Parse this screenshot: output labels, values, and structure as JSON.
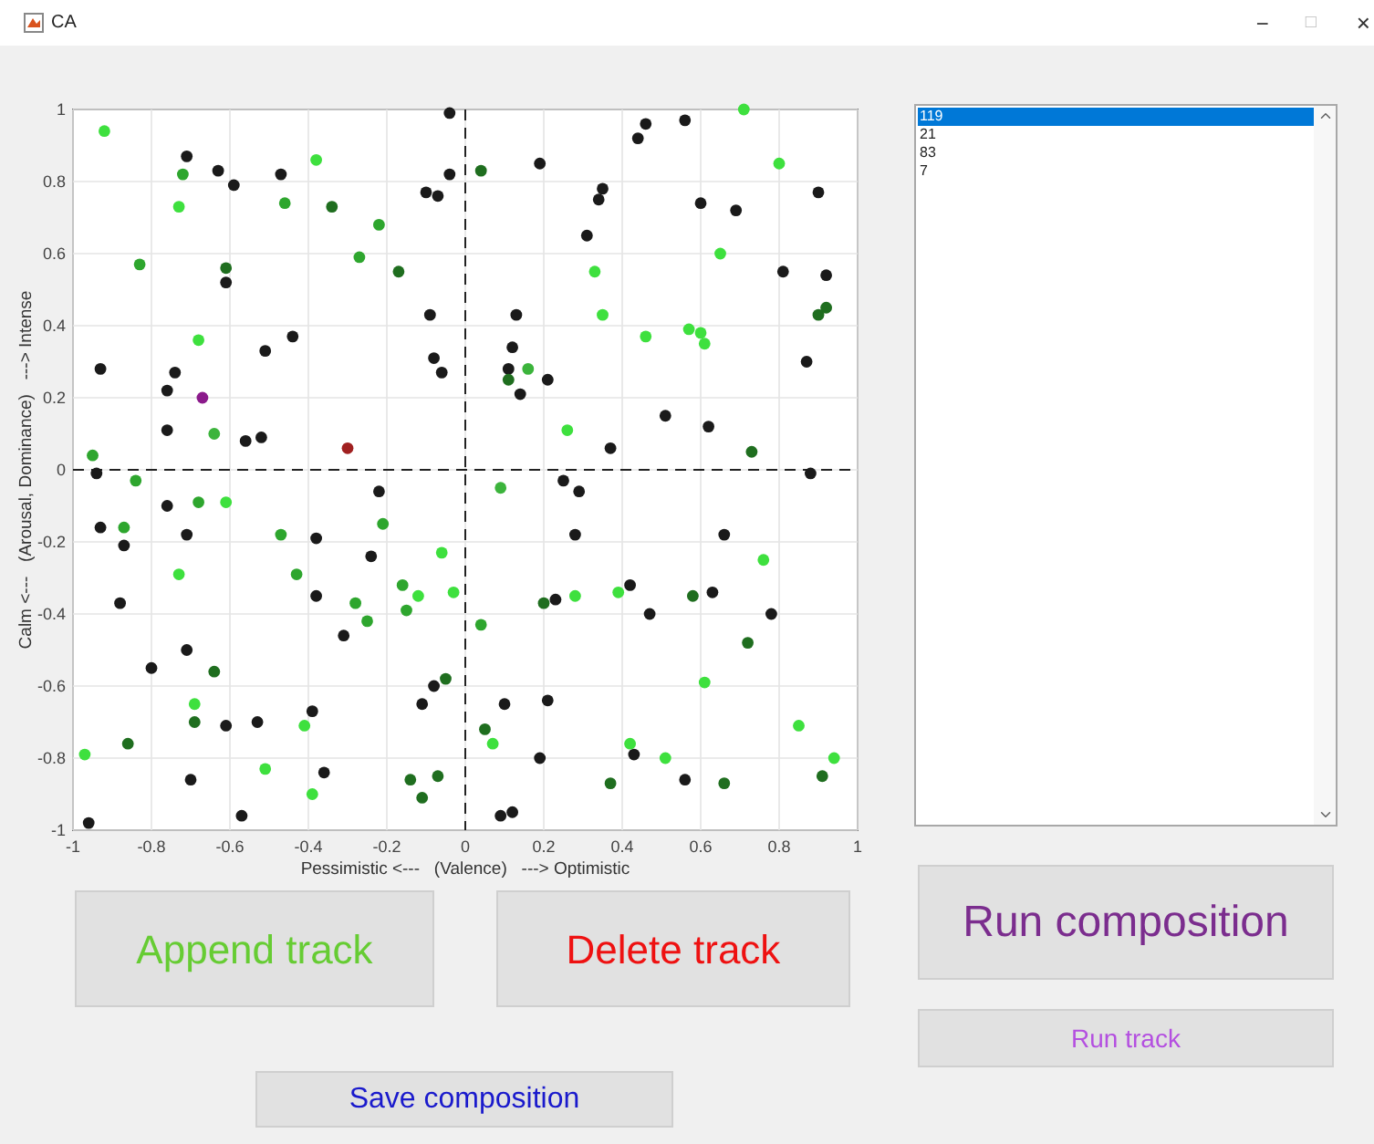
{
  "window": {
    "title": "CA",
    "controls": [
      "−",
      "□",
      "×"
    ]
  },
  "chart": {
    "chart_data": {
      "type": "scatter",
      "xlabel": "Pessimistic <---   (Valence)   ---> Optimistic",
      "ylabel": "Calm <---   (Arousal, Dominance)   ---> Intense",
      "xlim": [
        -1,
        1
      ],
      "ylim": [
        -1,
        1
      ],
      "xticks": [
        {
          "value": -1,
          "label": "-1"
        },
        {
          "value": -0.8,
          "label": "-0.8"
        },
        {
          "value": -0.6,
          "label": "-0.6"
        },
        {
          "value": -0.4,
          "label": "-0.4"
        },
        {
          "value": -0.2,
          "label": "-0.2"
        },
        {
          "value": 0,
          "label": "0"
        },
        {
          "value": 0.2,
          "label": "0.2"
        },
        {
          "value": 0.4,
          "label": "0.4"
        },
        {
          "value": 0.6,
          "label": "0.6"
        },
        {
          "value": 0.8,
          "label": "0.8"
        },
        {
          "value": 1,
          "label": "1"
        }
      ],
      "yticks": [
        {
          "value": -1,
          "label": "-1"
        },
        {
          "value": -0.8,
          "label": "-0.8"
        },
        {
          "value": -0.6,
          "label": "-0.6"
        },
        {
          "value": -0.4,
          "label": "-0.4"
        },
        {
          "value": -0.2,
          "label": "-0.2"
        },
        {
          "value": 0,
          "label": "0"
        },
        {
          "value": 0.2,
          "label": "0.2"
        },
        {
          "value": 0.4,
          "label": "0.4"
        },
        {
          "value": 0.6,
          "label": "0.6"
        },
        {
          "value": 0.8,
          "label": "0.8"
        },
        {
          "value": 1,
          "label": "1"
        }
      ],
      "grid": true,
      "series": [
        {
          "color": "#1a1a1a",
          "x": [
            -0.93,
            -0.71,
            -0.76,
            -0.74,
            -0.76,
            -0.63,
            -0.59,
            -0.61,
            -0.47,
            -0.51,
            -0.44,
            -0.56,
            -0.52,
            -0.1,
            -0.07,
            -0.04,
            -0.04,
            -0.09,
            -0.08,
            -0.06,
            -0.94,
            -0.22,
            0.46,
            0.44,
            0.56,
            0.19,
            0.35,
            0.34,
            0.31,
            0.6,
            0.69,
            0.9,
            0.81,
            0.92,
            0.13,
            0.12,
            0.11,
            0.21,
            0.14,
            0.51,
            0.62,
            0.87,
            0.37,
            0.88,
            0.25,
            0.29,
            -0.76,
            -0.93,
            -0.71,
            -0.87,
            -0.38,
            -0.24,
            -0.88,
            -0.38,
            -0.31,
            -0.71,
            -0.8,
            -0.08,
            -0.11,
            -0.61,
            -0.53,
            -0.39,
            -0.7,
            -0.36,
            -0.57,
            -0.96,
            0.28,
            0.66,
            0.42,
            0.23,
            0.63,
            0.47,
            0.78,
            0.1,
            0.21,
            0.19,
            0.43,
            0.56,
            0.09,
            0.12
          ],
          "values": [
            0.28,
            0.87,
            0.22,
            0.27,
            0.11,
            0.83,
            0.79,
            0.52,
            0.82,
            0.33,
            0.37,
            0.08,
            0.09,
            0.77,
            0.76,
            0.82,
            0.99,
            0.43,
            0.31,
            0.27,
            -0.01,
            -0.06,
            0.96,
            0.92,
            0.97,
            0.85,
            0.78,
            0.75,
            0.65,
            0.74,
            0.72,
            0.77,
            0.55,
            0.54,
            0.43,
            0.34,
            0.28,
            0.25,
            0.21,
            0.15,
            0.12,
            0.3,
            0.06,
            -0.01,
            -0.03,
            -0.06,
            -0.1,
            -0.16,
            -0.18,
            -0.21,
            -0.19,
            -0.24,
            -0.37,
            -0.35,
            -0.46,
            -0.5,
            -0.55,
            -0.6,
            -0.65,
            -0.71,
            -0.7,
            -0.67,
            -0.86,
            -0.84,
            -0.96,
            -0.98,
            -0.18,
            -0.18,
            -0.32,
            -0.36,
            -0.34,
            -0.4,
            -0.4,
            -0.65,
            -0.64,
            -0.8,
            -0.79,
            -0.86,
            -0.96,
            -0.95
          ]
        },
        {
          "color": "#1f6e1f",
          "x": [
            -0.61,
            -0.34,
            -0.17,
            0.04,
            0.73,
            0.9,
            0.92,
            0.11,
            -0.05,
            -0.14,
            -0.07,
            -0.11,
            0.2,
            0.58,
            0.72,
            0.05,
            0.37,
            0.66,
            0.91,
            -0.86,
            -0.64,
            -0.69
          ],
          "values": [
            0.56,
            0.73,
            0.55,
            0.83,
            0.05,
            0.43,
            0.45,
            0.25,
            -0.58,
            -0.86,
            -0.85,
            -0.91,
            -0.37,
            -0.35,
            -0.48,
            -0.72,
            -0.87,
            -0.87,
            -0.85,
            -0.76,
            -0.56,
            -0.7
          ]
        },
        {
          "color": "#2ea62e",
          "x": [
            -0.95,
            -0.83,
            -0.72,
            -0.46,
            -0.84,
            -0.27,
            -0.22,
            -0.68,
            -0.87,
            -0.47,
            -0.43,
            -0.21,
            -0.28,
            -0.25,
            -0.16,
            -0.15,
            0.04
          ],
          "values": [
            0.04,
            0.57,
            0.82,
            0.74,
            -0.03,
            0.59,
            0.68,
            -0.09,
            -0.16,
            -0.18,
            -0.29,
            -0.15,
            -0.37,
            -0.42,
            -0.32,
            -0.39,
            -0.43
          ]
        },
        {
          "color": "#3ee03e",
          "x": [
            -0.92,
            -0.73,
            -0.68,
            -0.38,
            0.8,
            0.71,
            0.65,
            0.33,
            0.35,
            0.46,
            0.57,
            0.6,
            0.61,
            0.26,
            -0.61,
            -0.73,
            -0.06,
            -0.12,
            -0.03,
            -0.69,
            -0.41,
            -0.97,
            -0.51,
            -0.39,
            0.28,
            0.39,
            0.76,
            0.61,
            0.85,
            0.07,
            0.42,
            0.51,
            0.94
          ],
          "values": [
            0.94,
            0.73,
            0.36,
            0.86,
            0.85,
            1.0,
            0.6,
            0.55,
            0.43,
            0.37,
            0.39,
            0.38,
            0.35,
            0.11,
            -0.09,
            -0.29,
            -0.23,
            -0.35,
            -0.34,
            -0.65,
            -0.71,
            -0.79,
            -0.83,
            -0.9,
            -0.35,
            -0.34,
            -0.25,
            -0.59,
            -0.71,
            -0.76,
            -0.76,
            -0.8,
            -0.8
          ]
        },
        {
          "color": "#8b1a8b",
          "x": [
            -0.67
          ],
          "values": [
            0.2
          ]
        },
        {
          "color": "#a02020",
          "x": [
            -0.3
          ],
          "values": [
            0.06
          ]
        },
        {
          "color": "#3cb43c",
          "x": [
            -0.64,
            0.16,
            0.09
          ],
          "values": [
            0.1,
            0.28,
            -0.05
          ]
        }
      ]
    }
  },
  "track_list": {
    "items": [
      {
        "label": "119",
        "selected": true
      },
      {
        "label": "21",
        "selected": false
      },
      {
        "label": "83",
        "selected": false
      },
      {
        "label": "7",
        "selected": false
      }
    ]
  },
  "append_button": {
    "label": "Append track",
    "color": "#66cc33"
  },
  "delete_button": {
    "label": "Delete track",
    "color": "#ee1111"
  },
  "run_composition_button": {
    "label": "Run composition",
    "color": "#7b2d8e"
  },
  "run_track_button": {
    "label": "Run track",
    "color": "#b44fe0"
  },
  "save_button": {
    "label": "Save composition",
    "color": "#1a1acc"
  }
}
